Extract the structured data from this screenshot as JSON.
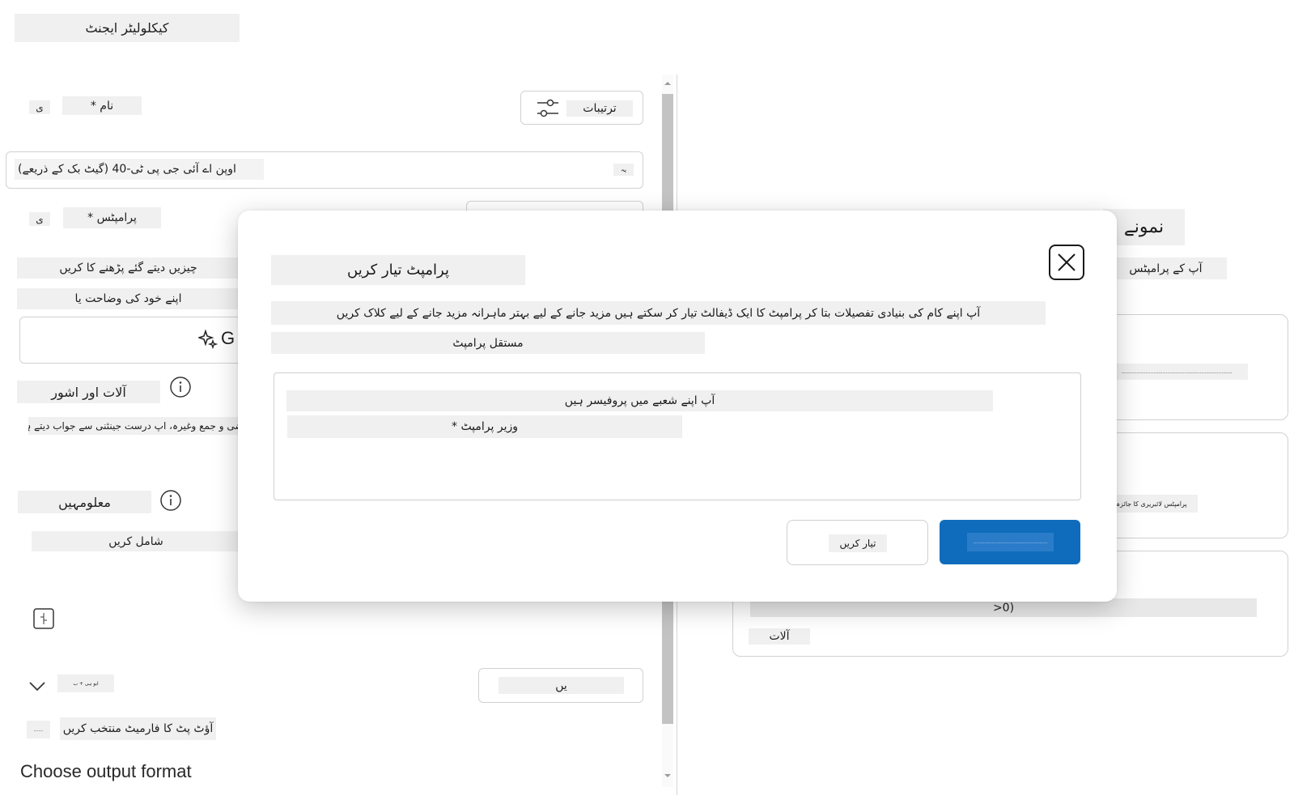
{
  "page": {
    "title": "کیکلولیٹر ایجنٹ"
  },
  "left": {
    "params_button": "ترتیبات",
    "name_label": "* نام",
    "name_hint": "ی",
    "model_value": "اوپن اے آئی جی پی ٹی-40 (گیٹ بک کے ذریعے)",
    "model_icon_text": "یہ",
    "prompts_label": "* پرامپٹس",
    "prompts_hint": "ی",
    "prompts_desc1": "چیزیں دیتے گئے پڑھنے کا کریں",
    "prompts_desc2": "اپنے خود کی وضاحت یا",
    "generate_label": "G",
    "tools_label": "آلات اور اشور",
    "tools_desc": "مرضی و جمع وغیرہ، اپ درست جینئنی سے جواب دیتے ہیں",
    "knowledge_label": "معلومہیں",
    "knowledge_action": "شامل کریں",
    "save_hint": "ابو ہی + ب",
    "save_button": "یں",
    "output_hint": "......",
    "output_desc": "آؤٹ پٹ کا فارمیٹ منتخب کریں",
    "choose_output": "Choose output format"
  },
  "right": {
    "title": "نمونے",
    "subtitle": "آپ کے پرامپٹس",
    "card1_text": "........................................................................",
    "card2_text": "پرامپٹس لائبریری کا جائزہ",
    "card3_value": ">0)",
    "card3_label": "آلات"
  },
  "dialog": {
    "title": "پرامپٹ تیار کریں",
    "description_line1": "آپ اپنے کام کی بنیادی تفصیلات بتا کر پرامپٹ کا ایک ڈیفالٹ تیار کر سکتے ہیں مزید جانے کے لیے بہتر ماہرانہ مزید جانے کے لیے کلاک کریں",
    "description_line2": "مستقل پرامپٹ",
    "input_line1": "آپ اپنے شعبے میں پروفیسر ہیں",
    "input_line2": "* وزیر پرامپٹ",
    "cancel_label": "تیار کریں",
    "primary_label": "................................................"
  },
  "colors": {
    "primary": "#0f6cbd",
    "chip": "#f0f0f0",
    "border": "#d1d1d1"
  }
}
